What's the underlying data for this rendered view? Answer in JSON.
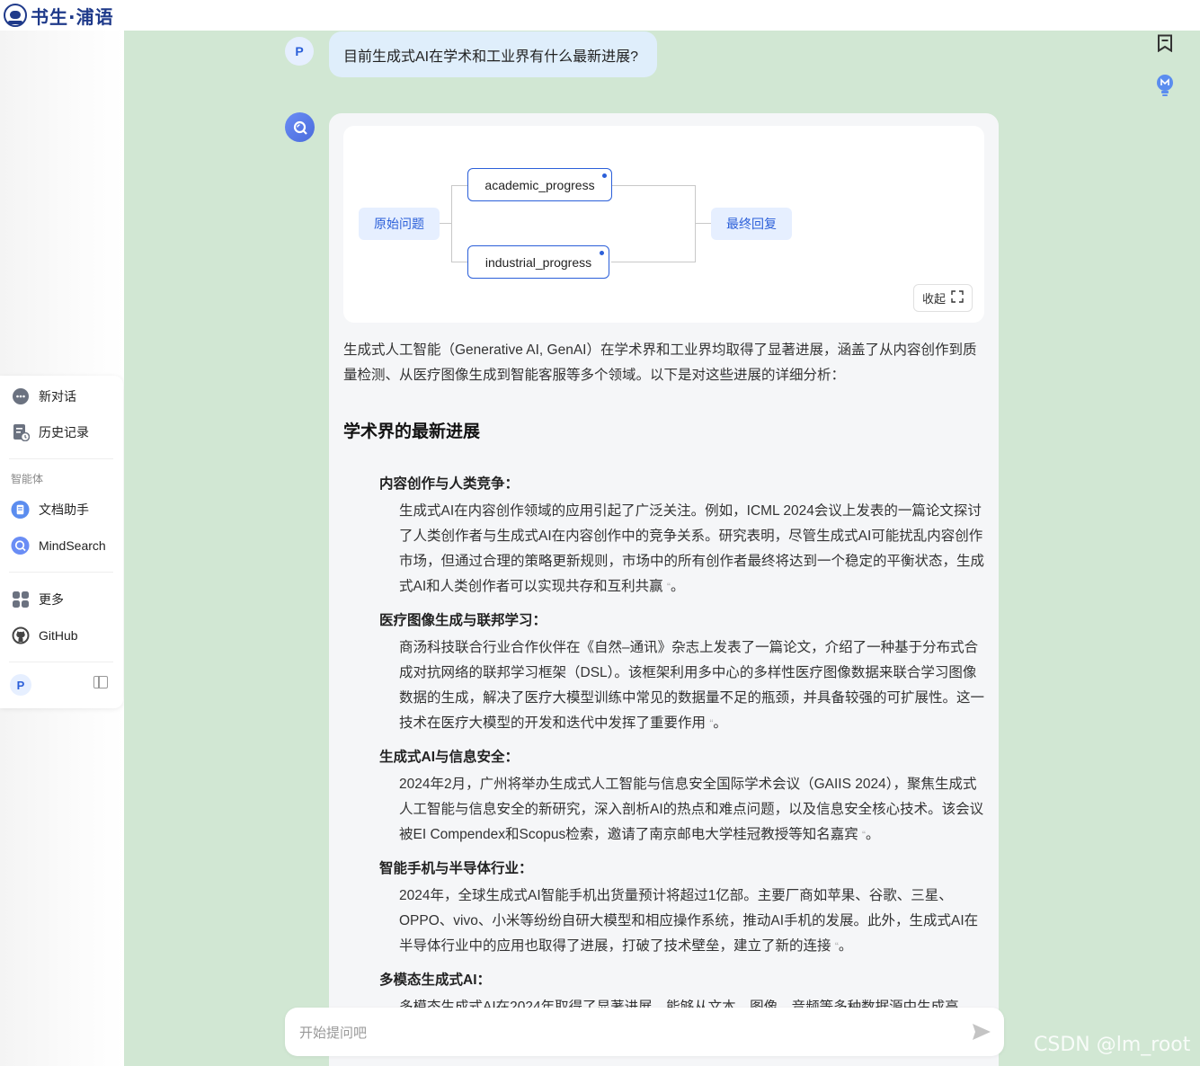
{
  "app": {
    "logo_text": "书生·浦语"
  },
  "sidebar": {
    "new_chat": "新对话",
    "history": "历史记录",
    "section_label": "智能体",
    "agents": [
      {
        "label": "文档助手",
        "icon": "document-assistant-icon"
      },
      {
        "label": "MindSearch",
        "icon": "mindsearch-icon"
      }
    ],
    "more": "更多",
    "github": "GitHub",
    "user_initial": "P"
  },
  "conversation": {
    "user_initial": "P",
    "question": "目前生成式AI在学术和工业界有什么最新进展?",
    "graph": {
      "start_node": "原始问题",
      "sub_nodes": [
        "academic_progress",
        "industrial_progress"
      ],
      "end_node": "最终回复",
      "collapse_label": "收起"
    },
    "intro": "生成式人工智能（Generative AI, GenAI）在学术界和工业界均取得了显著进展，涵盖了从内容创作到质量检测、从医疗图像生成到智能客服等多个领域。以下是对这些进展的详细分析：",
    "section_title": "学术界的最新进展",
    "items": [
      {
        "title": "内容创作与人类竞争：",
        "body": "生成式AI在内容创作领域的应用引起了广泛关注。例如，ICML 2024会议上发表的一篇论文探讨了人类创作者与生成式AI在内容创作中的竞争关系。研究表明，尽管生成式AI可能扰乱内容创作市场，但通过合理的策略更新规则，市场中的所有创作者最终将达到一个稳定的平衡状态，生成式AI和人类创作者可以实现共存和互利共赢",
        "tail": "。"
      },
      {
        "title": "医疗图像生成与联邦学习：",
        "body": "商汤科技联合行业合作伙伴在《自然–通讯》杂志上发表了一篇论文，介绍了一种基于分布式合成对抗网络的联邦学习框架（DSL）。该框架利用多中心的多样性医疗图像数据来联合学习图像数据的生成，解决了医疗大模型训练中常见的数据量不足的瓶颈，并具备较强的可扩展性。这一技术在医疗大模型的开发和迭代中发挥了重要作用",
        "tail": "。"
      },
      {
        "title": "生成式AI与信息安全：",
        "body": "2024年2月，广州将举办生成式人工智能与信息安全国际学术会议（GAIIS 2024），聚焦生成式人工智能与信息安全的新研究，深入剖析AI的热点和难点问题，以及信息安全核心技术。该会议被EI Compendex和Scopus检索，邀请了南京邮电大学桂冠教授等知名嘉宾",
        "tail": "。"
      },
      {
        "title": "智能手机与半导体行业：",
        "body": "2024年，全球生成式AI智能手机出货量预计将超过1亿部。主要厂商如苹果、谷歌、三星、OPPO、vivo、小米等纷纷自研大模型和相应操作系统，推动AI手机的发展。此外，生成式AI在半导体行业中的应用也取得了进展，打破了技术壁垒，建立了新的连接",
        "tail": "。"
      },
      {
        "title": "多模态生成式AI：",
        "body": "多模态生成式AI在2024年取得了显著进展，能够从文本、图像、音频等多种数据源中生成高",
        "tail": ""
      }
    ],
    "quote_mark": "“"
  },
  "input": {
    "placeholder": "开始提问吧"
  },
  "watermark": "CSDN @lm_root",
  "colors": {
    "background": "#d1e7d3",
    "accent": "#2b5fd9",
    "node_bg": "#e6efff"
  }
}
